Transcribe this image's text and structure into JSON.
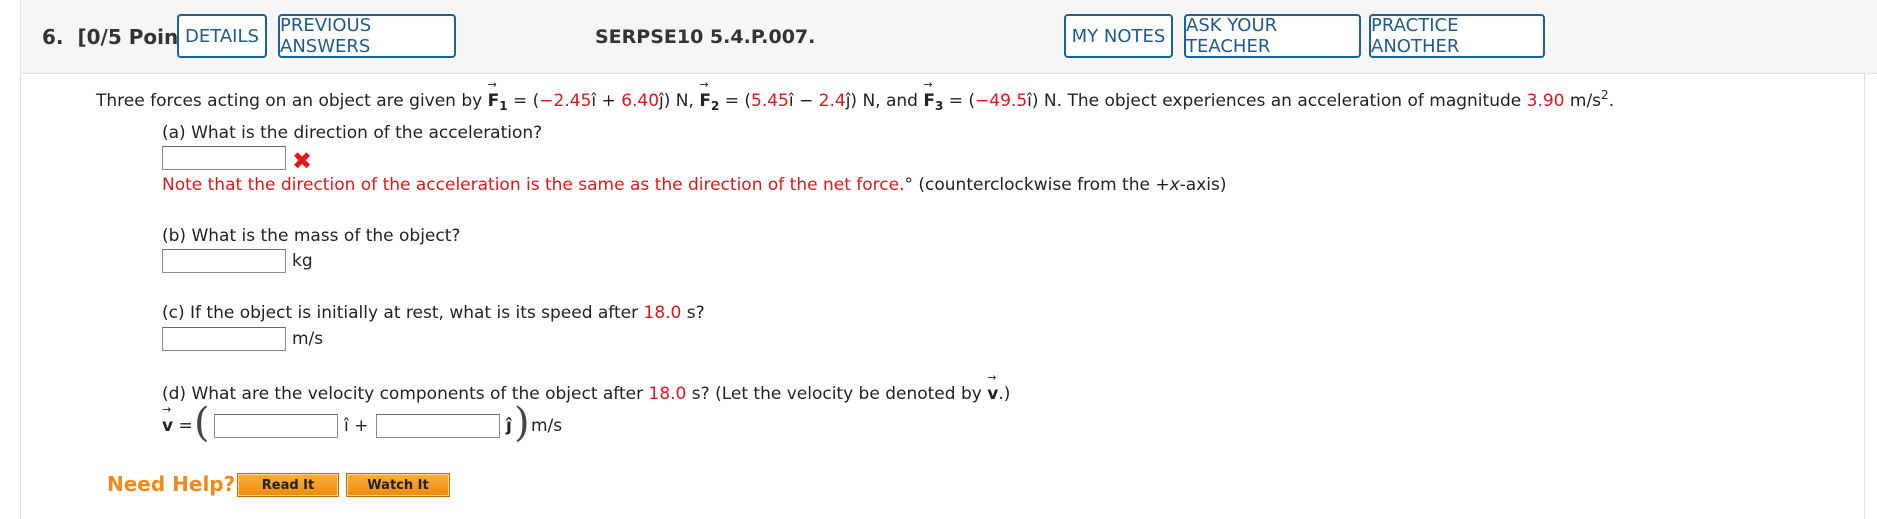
{
  "header": {
    "question_number": "6.",
    "points": "[0/5 Points]",
    "details_label": "DETAILS",
    "previous_answers_label": "PREVIOUS ANSWERS",
    "problem_code": "SERPSE10 5.4.P.007.",
    "my_notes_label": "MY NOTES",
    "ask_teacher_label": "ASK YOUR TEACHER",
    "practice_another_label": "PRACTICE ANOTHER"
  },
  "problem": {
    "intro": "Three forces acting on an object are given by",
    "f1_label": "F",
    "f1_sub": "1",
    "f1_eq": " = (",
    "f1_x": "−2.45",
    "f1_mid": "î + ",
    "f1_y": "6.40",
    "f1_tail": "ĵ) N,",
    "f2_label": "F",
    "f2_sub": "2",
    "f2_eq": " = (",
    "f2_x": "5.45",
    "f2_mid": "î − ",
    "f2_y": "2.4",
    "f2_tail": "ĵ) N, and",
    "f3_label": "F",
    "f3_sub": "3",
    "f3_eq": " = (",
    "f3_x": "−49.5",
    "f3_tail": "î) N. The object experiences an acceleration of magnitude",
    "accel_value": "3.90",
    "accel_unit": "m/s",
    "accel_exp": "2",
    "accel_end": "."
  },
  "part_a": {
    "question": "(a) What is the direction of the acceleration?",
    "feedback": "Note that the direction of the acceleration is the same as the direction of the net force.",
    "unit": "° (counterclockwise from the +",
    "axis": "x",
    "unit_end": "-axis)"
  },
  "part_b": {
    "question": "(b) What is the mass of the object?",
    "unit": "kg"
  },
  "part_c": {
    "question_start": "(c) If the object is initially at rest, what is its speed after",
    "time": "18.0",
    "question_end": "s?",
    "unit": "m/s"
  },
  "part_d": {
    "question_start": "(d) What are the velocity components of the object after",
    "time": "18.0",
    "question_mid": "s? (Let the velocity be denoted by",
    "v_symbol": "v",
    "question_end": ".)",
    "lhs": "v",
    "equals": "=",
    "i_hat": "î +",
    "j_hat": "ĵ",
    "unit": "m/s"
  },
  "help": {
    "label": "Need Help?",
    "read_it": "Read It",
    "watch_it": "Watch It"
  },
  "colors": {
    "accent_blue": "#1e6196",
    "value_red": "#e0181b",
    "help_orange": "#ee8b1c"
  }
}
